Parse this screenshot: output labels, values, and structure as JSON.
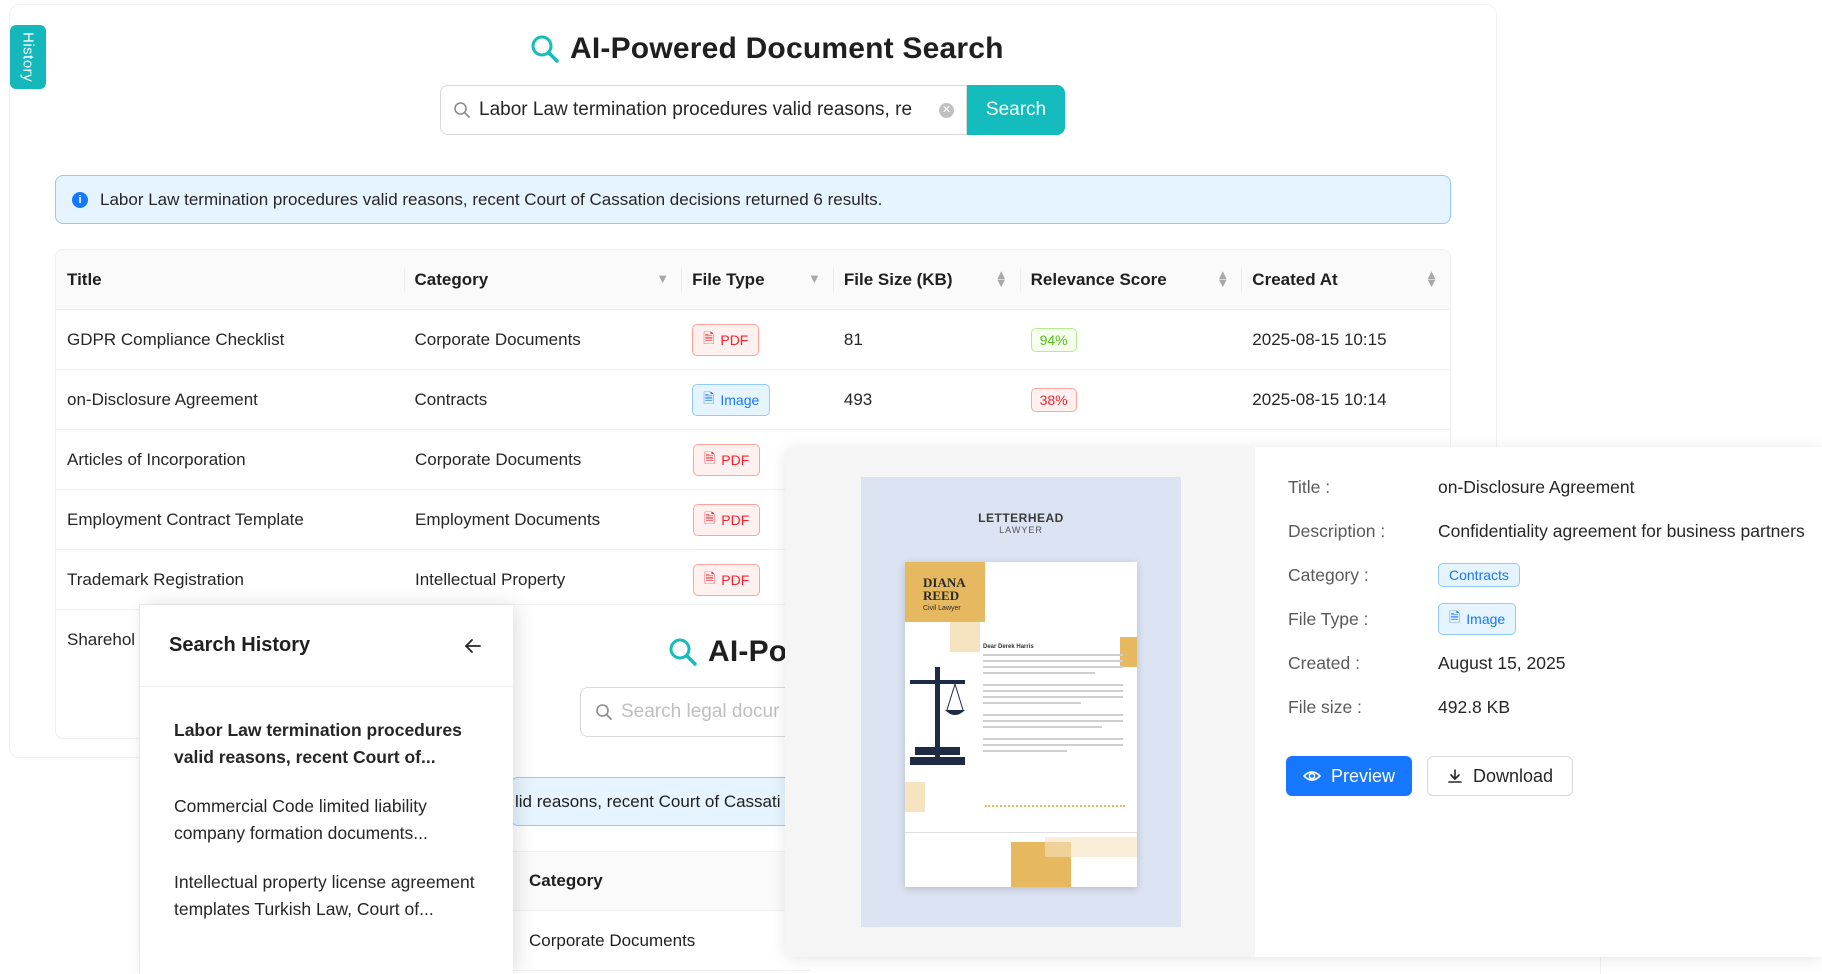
{
  "history_tab": {
    "label": "History"
  },
  "header": {
    "title": "AI-Powered Document Search",
    "search_value": "Labor Law termination procedures valid reasons, re",
    "search_button": "Search"
  },
  "alert": {
    "text": "Labor Law termination procedures valid reasons, recent Court of Cassation decisions returned 6 results."
  },
  "table": {
    "columns": [
      "Title",
      "Category",
      "File Type",
      "File Size (KB)",
      "Relevance Score",
      "Created At"
    ],
    "rows": [
      {
        "title": "GDPR Compliance Checklist",
        "category": "Corporate Documents",
        "file_type": "PDF",
        "file_size": "81",
        "score": "94%",
        "score_level": "high",
        "created": "2025-08-15 10:15"
      },
      {
        "title": "on-Disclosure Agreement",
        "category": "Contracts",
        "file_type": "Image",
        "file_size": "493",
        "score": "38%",
        "score_level": "low",
        "created": "2025-08-15 10:14"
      },
      {
        "title": "Articles of Incorporation",
        "category": "Corporate Documents",
        "file_type": "PDF"
      },
      {
        "title": "Employment Contract Template",
        "category": "Employment Documents",
        "file_type": "PDF"
      },
      {
        "title": "Trademark Registration",
        "category": "Intellectual Property",
        "file_type": "PDF"
      },
      {
        "title": "Sharehol"
      }
    ]
  },
  "page2": {
    "title": "AI-Po",
    "search_placeholder": "Search legal docur",
    "alert_fragment": "lid reasons, recent Court of Cassati",
    "col_category": "Category",
    "row1_category": "Corporate Documents"
  },
  "history_drawer": {
    "title": "Search History",
    "items": [
      {
        "line1": "Labor Law termination procedures",
        "line2": "valid reasons, recent Court of...",
        "active": true
      },
      {
        "line1": "Commercial Code limited liability",
        "line2": "company formation documents..."
      },
      {
        "line1": "Intellectual property license agreement",
        "line2": "templates Turkish Law, Court of..."
      }
    ]
  },
  "detail": {
    "thumbnail": {
      "heading": "LETTERHEAD",
      "subheading": "LAWYER",
      "name_line1": "DIANA",
      "name_line2": "REED",
      "role": "Civil Lawyer",
      "salutation": "Dear Derek Harris"
    },
    "fields": [
      {
        "label": "Title",
        "value": "on-Disclosure Agreement"
      },
      {
        "label": "Description",
        "value": "Confidentiality agreement for business partners"
      },
      {
        "label": "Category",
        "value": "Contracts",
        "kind": "tag"
      },
      {
        "label": "File Type",
        "value": "Image",
        "kind": "filetag"
      },
      {
        "label": "Created",
        "value": "August 15, 2025"
      },
      {
        "label": "File size",
        "value": "492.8 KB"
      }
    ],
    "preview_button": "Preview",
    "download_button": "Download"
  },
  "colors": {
    "accent": "#14bcbd",
    "primary": "#1677ff",
    "pdf": "#f5222d",
    "success": "#52c41a"
  }
}
